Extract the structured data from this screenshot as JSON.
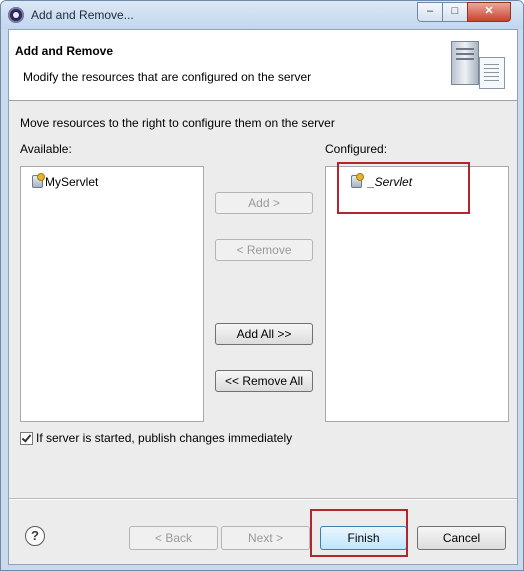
{
  "window": {
    "title": "Add and Remove...",
    "controls": {
      "minimize": "–",
      "maximize": "□",
      "close": "✕"
    }
  },
  "header": {
    "title": "Add and Remove",
    "description": "Modify the resources that are configured on the server",
    "icon": "server-icon"
  },
  "body": {
    "instruction": "Move resources to the right to configure them on the server",
    "available_label": "Available:",
    "configured_label": "Configured:",
    "available_items": [
      "MyServlet"
    ],
    "configured_items": [
      "_Servlet"
    ]
  },
  "buttons": {
    "add": "Add >",
    "remove": "< Remove",
    "add_all": "Add All >>",
    "remove_all": "<< Remove All"
  },
  "publish_checkbox": {
    "checked": true,
    "label": "If server is started, publish changes immediately"
  },
  "footer": {
    "help": "?",
    "back": "< Back",
    "next": "Next >",
    "finish": "Finish",
    "cancel": "Cancel"
  },
  "colors": {
    "highlight": "#b3262c",
    "finish_border": "#3c7fb1"
  }
}
